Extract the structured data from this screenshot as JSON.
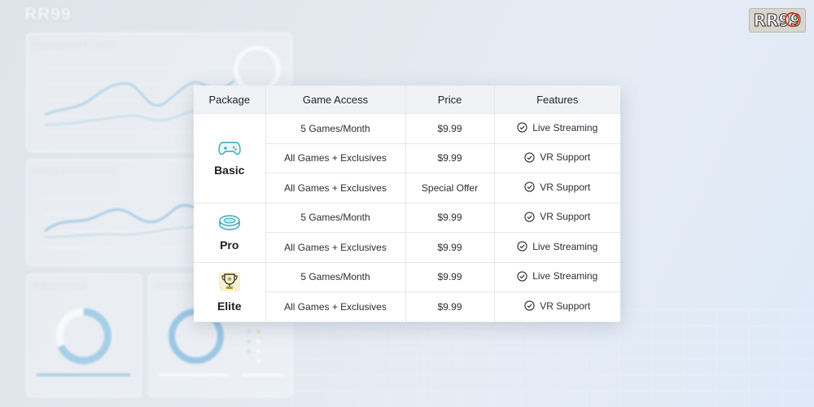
{
  "background": {
    "brand": "RR99",
    "panels": [
      {
        "title": "Engagement Metrics"
      },
      {
        "title": "Engagement Metrics"
      },
      {
        "title": "Season Stats"
      },
      {
        "title": "Season St"
      }
    ]
  },
  "logo": {
    "text": "RR99"
  },
  "table": {
    "headers": [
      "Package",
      "Game Access",
      "Price",
      "Features"
    ],
    "packages": [
      {
        "name": "Basic",
        "icon": "gamepad-icon",
        "rows": [
          {
            "access": "5 Games/Month",
            "price": "$9.99",
            "feature": "Live Streaming"
          },
          {
            "access": "All Games + Exclusives",
            "price": "$9.99",
            "feature": "VR Support"
          },
          {
            "access": "All Games + Exclusives",
            "price": "Special Offer",
            "feature": "VR Support"
          }
        ]
      },
      {
        "name": "Pro",
        "icon": "stadium-icon",
        "rows": [
          {
            "access": "5 Games/Month",
            "price": "$9.99",
            "feature": "VR Support"
          },
          {
            "access": "All Games + Exclusives",
            "price": "$9.99",
            "feature": "Live Streaming"
          }
        ]
      },
      {
        "name": "Elite",
        "icon": "trophy-icon",
        "rows": [
          {
            "access": "5 Games/Month",
            "price": "$9.99",
            "feature": "Live Streaming"
          },
          {
            "access": "All Games + Exclusives",
            "price": "$9.99",
            "feature": "VR Support"
          }
        ]
      }
    ]
  },
  "colors": {
    "accent_teal": "#3aa7b8",
    "trophy_gold": "#b8952a",
    "check_dark": "#2a2e34"
  }
}
